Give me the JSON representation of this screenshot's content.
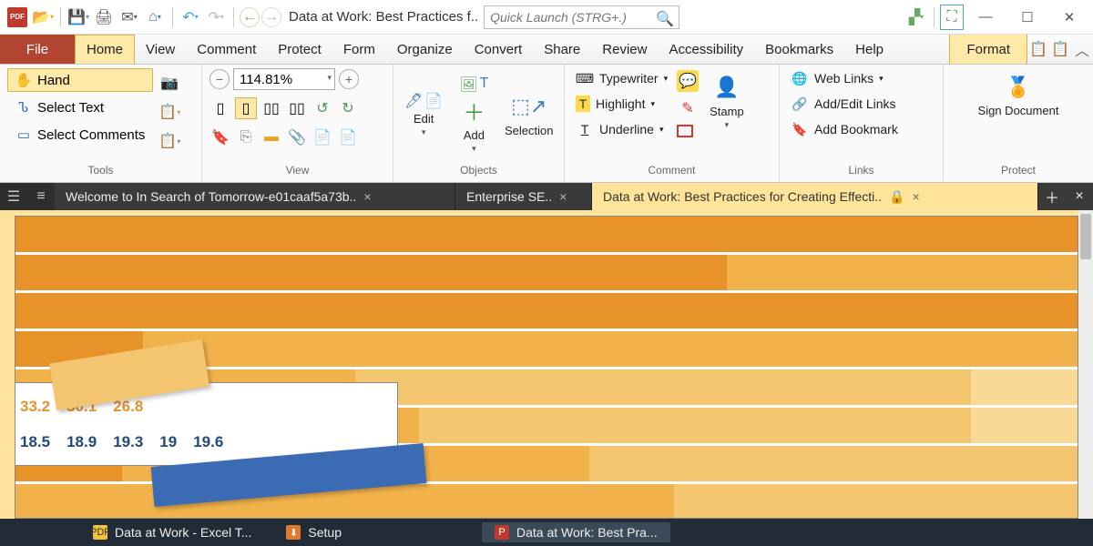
{
  "titlebar": {
    "document_title": "Data at Work: Best Practices f..",
    "search_placeholder": "Quick Launch (STRG+.)"
  },
  "menu": {
    "file": "File",
    "tabs": [
      "Home",
      "View",
      "Comment",
      "Protect",
      "Form",
      "Organize",
      "Convert",
      "Share",
      "Review",
      "Accessibility",
      "Bookmarks",
      "Help"
    ],
    "format": "Format"
  },
  "ribbon": {
    "tools": {
      "hand": "Hand",
      "select_text": "Select Text",
      "select_comments": "Select Comments",
      "group": "Tools"
    },
    "view": {
      "zoom": "114.81%",
      "group": "View"
    },
    "objects": {
      "edit": "Edit",
      "add": "Add",
      "selection": "Selection",
      "group": "Objects"
    },
    "comment": {
      "typewriter": "Typewriter",
      "highlight": "Highlight",
      "underline": "Underline",
      "stamp": "Stamp",
      "group": "Comment"
    },
    "links": {
      "web": "Web Links",
      "addedit": "Add/Edit Links",
      "bookmark": "Add Bookmark",
      "group": "Links"
    },
    "protect": {
      "sign": "Sign Document",
      "group": "Protect"
    }
  },
  "doctabs": {
    "tab1": "Welcome to In Search of Tomorrow-e01caaf5a73b..",
    "tab2": "Enterprise SE..",
    "tab3": "Data at Work: Best Practices for Creating Effecti.."
  },
  "document": {
    "row1_values": [
      "33.2",
      "30.1",
      "26.8"
    ],
    "row2_values": [
      "18.5",
      "18.9",
      "19.3",
      "19",
      "19.6"
    ]
  },
  "taskbar": {
    "item1": "Data at Work - Excel T...",
    "item2": "Setup",
    "item3": "Data at Work: Best Pra..."
  },
  "chart_data": {
    "type": "bar",
    "note": "Partial zoomed-in view of stacked horizontal bar chart inside a PDF. Only visible fragmentary data labels captured.",
    "visible_rows": [
      {
        "color_scheme": "orange",
        "heading_values": [
          33.2,
          30.1,
          26.8
        ]
      },
      {
        "color_scheme": "blue",
        "heading_values": [
          18.5,
          18.9,
          19.3,
          19,
          19.6
        ]
      }
    ]
  }
}
